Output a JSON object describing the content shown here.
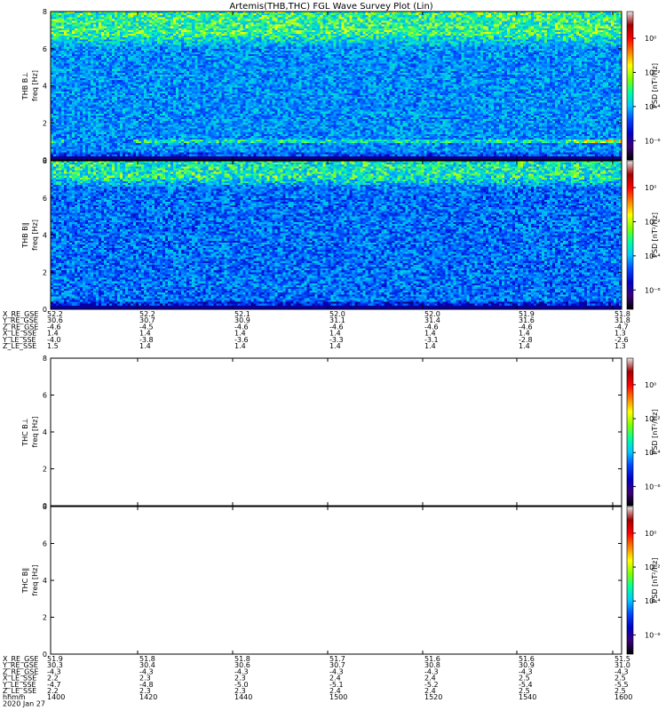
{
  "title": "Artemis(THB,THC) FGL Wave Survey Plot (Lin)",
  "y_ticks": [
    "0",
    "2",
    "4",
    "6",
    "8"
  ],
  "y_unit": "freq [Hz]",
  "colorbar": {
    "label": "PSD [nT²/Hz]",
    "ticks": [
      "10⁰",
      "10⁻²",
      "10⁻⁴",
      "10⁻⁶"
    ],
    "colors": [
      "#e6e6e6",
      "#a00000",
      "#ff0000",
      "#ff7f00",
      "#ffff00",
      "#7fff00",
      "#00ff9f",
      "#00c8ff",
      "#0046ff",
      "#0000c8",
      "#3c0078",
      "#000000"
    ]
  },
  "panels": [
    {
      "label": "THB B⊥",
      "has_data": true
    },
    {
      "label": "THB B∥",
      "has_data": true
    },
    {
      "label": "THC B⊥",
      "has_data": false
    },
    {
      "label": "THC B∥",
      "has_data": false
    }
  ],
  "ephem_top": {
    "labels": [
      "X_RE_GSE",
      "Y_RE_GSE",
      "Z_RE_GSE",
      "X_LE_SSE",
      "Y_LE_SSE",
      "Z_LE_SSE"
    ],
    "columns": [
      [
        "52.2",
        "30.6",
        "-4.6",
        "1.4",
        "-4.0",
        "1.5"
      ],
      [
        "52.2",
        "30.7",
        "-4.5",
        "1.4",
        "-3.8",
        "1.4"
      ],
      [
        "52.1",
        "30.9",
        "-4.6",
        "1.4",
        "-3.6",
        "1.4"
      ],
      [
        "52.0",
        "31.1",
        "-4.6",
        "1.4",
        "-3.3",
        "1.4"
      ],
      [
        "52.0",
        "31.4",
        "-4.6",
        "1.4",
        "-3.1",
        "1.4"
      ],
      [
        "51.9",
        "31.6",
        "-4.6",
        "1.4",
        "-2.8",
        "1.4"
      ],
      [
        "51.8",
        "31.8",
        "-4.7",
        "1.3",
        "-2.6",
        "1.3"
      ]
    ]
  },
  "ephem_bottom": {
    "labels": [
      "X_RE_GSE",
      "Y_RE_GSE",
      "Z_RE_GSE",
      "X_LE_SSE",
      "Y_LE_SSE",
      "Z_LE_SSE",
      "hhmm",
      "2020 Jan 27"
    ],
    "columns": [
      [
        "51.9",
        "30.3",
        "-4.3",
        "2.2",
        "-4.7",
        "2.2",
        "1400"
      ],
      [
        "51.8",
        "30.4",
        "-4.3",
        "2.3",
        "-4.8",
        "2.3",
        "1420"
      ],
      [
        "51.8",
        "30.6",
        "-4.3",
        "2.3",
        "-5.0",
        "2.3",
        "1440"
      ],
      [
        "51.7",
        "30.7",
        "-4.3",
        "2.4",
        "-5.1",
        "2.4",
        "1500"
      ],
      [
        "51.6",
        "30.8",
        "-4.3",
        "2.4",
        "-5.2",
        "2.4",
        "1520"
      ],
      [
        "51.6",
        "30.9",
        "-4.3",
        "2.5",
        "-5.4",
        "2.5",
        "1540"
      ],
      [
        "51.5",
        "31.0",
        "-4.3",
        "2.5",
        "-5.5",
        "2.5",
        "1600"
      ]
    ]
  },
  "chart_data": {
    "type": "heatmap",
    "title": "Artemis(THB,THC) FGL Wave Survey Plot (Lin)",
    "date": "2020 Jan 27",
    "x_time_labels": [
      "1400",
      "1420",
      "1440",
      "1500",
      "1520",
      "1540",
      "1600"
    ],
    "x_range": [
      "1400",
      "1600"
    ],
    "ylabel": "freq [Hz]",
    "ylim": [
      0,
      8
    ],
    "y_ticks": [
      0,
      2,
      4,
      6,
      8
    ],
    "color_scale": "log",
    "color_label": "PSD [nT²/Hz]",
    "color_range": [
      "1e-6",
      "1e1"
    ],
    "panels": [
      {
        "name": "THB B⊥",
        "background_log10_psd": -4.5,
        "high_freq_band_hz": [
          6.0,
          8.0
        ],
        "high_freq_band_log10_psd": -2.5,
        "emission_line_hz": 1.0,
        "gap_line_hz": 0.1
      },
      {
        "name": "THB B∥",
        "background_log10_psd": -4.8,
        "high_freq_band_hz": [
          6.5,
          8.0
        ],
        "high_freq_band_log10_psd": -2.8,
        "gap_line_hz": 0.1
      },
      {
        "name": "THC B⊥",
        "values": []
      },
      {
        "name": "THC B∥",
        "values": []
      }
    ]
  }
}
